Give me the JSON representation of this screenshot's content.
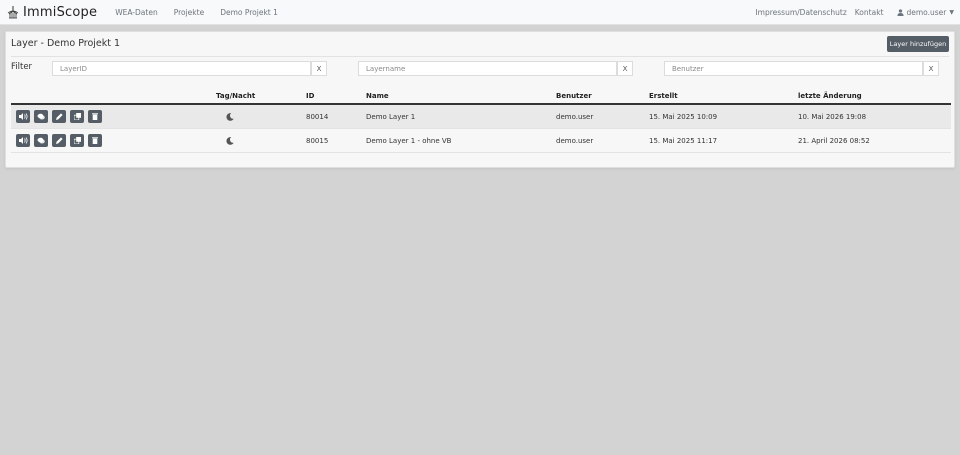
{
  "navbar": {
    "brand": "ImmiScope",
    "links": [
      "WEA-Daten",
      "Projekte",
      "Demo Projekt 1"
    ],
    "right_links": [
      "Impressum/Datenschutz",
      "Kontakt"
    ],
    "user": "demo.user"
  },
  "card": {
    "title": "Layer - Demo Projekt 1",
    "add_button": "Layer hinzufügen"
  },
  "filter": {
    "label": "Filter",
    "layerid_placeholder": "LayerID",
    "layername_placeholder": "Layername",
    "benutzer_placeholder": "Benutzer",
    "clear_label": "X"
  },
  "table": {
    "headers": {
      "tagnacht": "Tag/Nacht",
      "id": "ID",
      "name": "Name",
      "benutzer": "Benutzer",
      "erstellt": "Erstellt",
      "letzte": "letzte Änderung"
    },
    "rows": [
      {
        "id": "80014",
        "name": "Demo Layer 1",
        "benutzer": "demo.user",
        "erstellt": "15. Mai 2025 10:09",
        "letzte": "10. Mai 2026 19:08"
      },
      {
        "id": "80015",
        "name": "Demo Layer 1 - ohne VB",
        "benutzer": "demo.user",
        "erstellt": "15. Mai 2025 11:17",
        "letzte": "21. April 2026 08:52"
      }
    ],
    "action_icons": [
      "sound-icon",
      "map-layers-icon",
      "edit-pencil-icon",
      "copy-icon",
      "trash-icon"
    ],
    "mode_icon": "moon-icon"
  },
  "colors": {
    "page_bg": "#d3d3d3",
    "button_bg": "#555d66",
    "row_highlight": "#e9e9e9"
  }
}
